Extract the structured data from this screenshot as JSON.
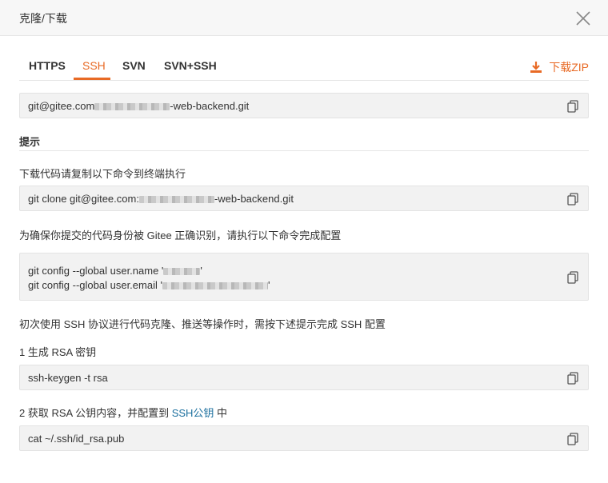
{
  "dialog": {
    "title": "克隆/下载"
  },
  "tabs": [
    {
      "label": "HTTPS"
    },
    {
      "label": "SSH",
      "active": true
    },
    {
      "label": "SVN"
    },
    {
      "label": "SVN+SSH"
    }
  ],
  "download_zip": "下载ZIP",
  "repo_url": {
    "prefix": "git@gitee.com",
    "suffix": "-web-backend.git"
  },
  "section_title": "提示",
  "instructions": {
    "clone_hint": "下载代码请复制以下命令到终端执行",
    "clone_cmd_prefix": "git clone git@gitee.com:",
    "clone_cmd_suffix": "-web-backend.git",
    "identity_hint": "为确保你提交的代码身份被 Gitee 正确识别，请执行以下命令完成配置",
    "config_name_prefix": "git config --global user.name '",
    "config_email_prefix": "git config --global user.email '",
    "quote_close": "'",
    "ssh_first_use": "初次使用 SSH 协议进行代码克隆、推送等操作时，需按下述提示完成 SSH 配置",
    "step1_label": "1 生成 RSA 密钥",
    "step1_cmd": "ssh-keygen -t rsa",
    "step2_label_prefix": "2 获取 RSA 公钥内容，并配置到 ",
    "step2_link": "SSH公钥",
    "step2_label_suffix": " 中",
    "step2_cmd": "cat ~/.ssh/id_rsa.pub"
  },
  "colors": {
    "accent": "#e86a25",
    "link": "#1b6f9e",
    "code_bg": "#f2f2f2"
  }
}
